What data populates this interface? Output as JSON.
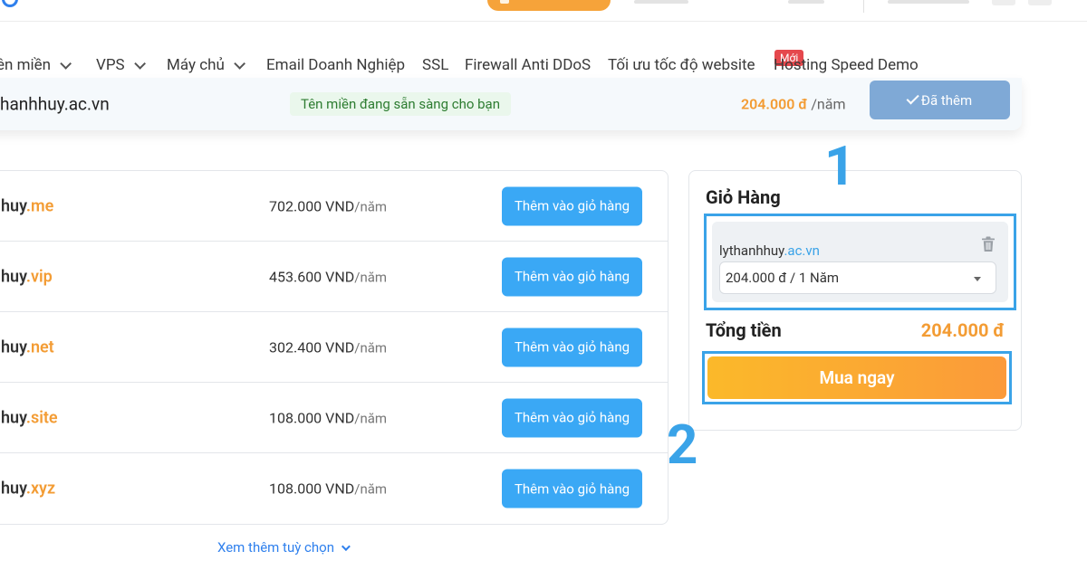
{
  "colors": {
    "accent_blue": "#3aa8f5",
    "price_orange": "#f39c34",
    "annotation_blue": "#3aa3e8",
    "new_badge_red": "#e5484d"
  },
  "nav": {
    "items": [
      {
        "label": "ên miền",
        "dropdown": true
      },
      {
        "label": "VPS",
        "dropdown": true
      },
      {
        "label": "Máy chủ",
        "dropdown": true
      },
      {
        "label": "Email Doanh Nghiệp",
        "dropdown": false
      },
      {
        "label": "SSL",
        "dropdown": false
      },
      {
        "label": "Firewall Anti DDoS",
        "dropdown": false
      },
      {
        "label": "Tối ưu tốc độ website",
        "dropdown": false
      },
      {
        "label": "Hosting Speed Demo",
        "dropdown": false
      }
    ],
    "new_badge": "Mới"
  },
  "search_result": {
    "domain": "hanhhuy.ac.vn",
    "status": "Tên miền đang sẵn sàng cho bạn",
    "price": "204.000 đ",
    "price_unit": "/năm",
    "added_label": "Đã thêm"
  },
  "suggestions": {
    "add_label": "Thêm vào giỏ hàng",
    "price_unit": "/năm",
    "rows": [
      {
        "sld": "huy",
        "tld": ".me",
        "price": "702.000 VND"
      },
      {
        "sld": "huy",
        "tld": ".vip",
        "price": "453.600 VND"
      },
      {
        "sld": "huy",
        "tld": ".net",
        "price": "302.400 VND"
      },
      {
        "sld": "huy",
        "tld": ".site",
        "price": "108.000 VND"
      },
      {
        "sld": "huy",
        "tld": ".xyz",
        "price": "108.000 VND"
      }
    ],
    "more_label": "Xem thêm tuỳ chọn"
  },
  "cart": {
    "title": "Giỏ Hàng",
    "item": {
      "sld": "lythanhhuy",
      "tld": ".ac.vn",
      "period": "204.000 đ / 1 Năm"
    },
    "total_label": "Tổng tiền",
    "total_value": "204.000 đ",
    "buy_label": "Mua ngay"
  },
  "annotations": {
    "one": "1",
    "two": "2"
  }
}
